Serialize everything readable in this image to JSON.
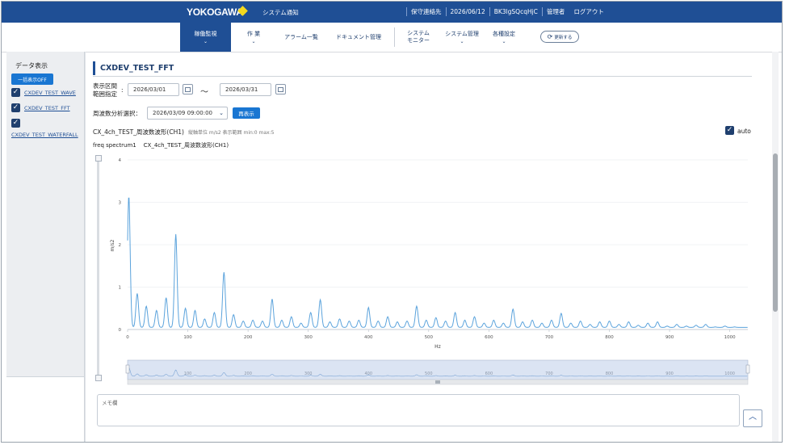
{
  "header": {
    "logo": "YOKOGAWA",
    "system_notice": "システム通知",
    "maintenance_contact": "保守連絡先",
    "date": "2026/06/12",
    "user_id": "BK3lgSQcqHjC",
    "role": "管理者",
    "logout": "ログアウト"
  },
  "nav": {
    "items": [
      {
        "label": "稼働監視",
        "chevron": true,
        "active": true
      },
      {
        "label": "作 業",
        "chevron": true
      },
      {
        "label": "アラーム一覧",
        "chevron": false
      },
      {
        "label": "ドキュメント管理",
        "chevron": false
      },
      {
        "label": "システム\nモニター",
        "chevron": false
      },
      {
        "label": "システム管理",
        "chevron": true
      },
      {
        "label": "各種設定",
        "chevron": true
      }
    ],
    "refresh": "更新する"
  },
  "sidebar": {
    "title": "データ表示",
    "toggle_all": "一括表示OFF",
    "items": [
      {
        "label": "CXDEV_TEST_WAVE",
        "checked": true
      },
      {
        "label": "CXDEV_TEST_FFT",
        "checked": true
      },
      {
        "label": "CXDEV_TEST_WATERFALL",
        "checked": true
      }
    ]
  },
  "main": {
    "title": "CXDEV_TEST_FFT",
    "range_label": "表示区間\n範囲指定",
    "date_from": "2026/03/01",
    "tilde": "〜",
    "date_to": "2026/03/31",
    "freq_label": "周波数分析選択：",
    "freq_value": "2026/03/09 09:00:00",
    "redisplay": "再表示",
    "chart_header": "CX_4ch_TEST_周波数波形(CH1)",
    "chart_header_sub": "縦軸単位 m/s2 表示範囲 min:0 max:5",
    "auto_label": "auto",
    "chart_subtitle": "freq spectrum1    CX_4ch_TEST_周波数波形(CH1)",
    "memo_label": "メモ欄"
  },
  "chart_data": {
    "type": "line",
    "xlabel": "Hz",
    "ylabel": "m/s2",
    "xlim": [
      0,
      1030
    ],
    "ylim": [
      0,
      4
    ],
    "x_ticks": [
      0,
      100,
      200,
      300,
      400,
      500,
      600,
      700,
      800,
      900,
      1000
    ],
    "y_ticks": [
      0,
      1,
      2,
      3,
      4
    ],
    "series": [
      {
        "color": "#5ba3dc",
        "peaks": [
          [
            2,
            3.15
          ],
          [
            16,
            0.85
          ],
          [
            31,
            0.55
          ],
          [
            48,
            0.45
          ],
          [
            64,
            0.75
          ],
          [
            80,
            2.25
          ],
          [
            96,
            0.5
          ],
          [
            112,
            0.45
          ],
          [
            128,
            0.25
          ],
          [
            144,
            0.4
          ],
          [
            160,
            1.35
          ],
          [
            176,
            0.35
          ],
          [
            192,
            0.2
          ],
          [
            208,
            0.22
          ],
          [
            224,
            0.2
          ],
          [
            240,
            0.72
          ],
          [
            256,
            0.22
          ],
          [
            272,
            0.3
          ],
          [
            288,
            0.15
          ],
          [
            304,
            0.4
          ],
          [
            320,
            0.7
          ],
          [
            336,
            0.18
          ],
          [
            352,
            0.25
          ],
          [
            368,
            0.2
          ],
          [
            384,
            0.22
          ],
          [
            400,
            0.52
          ],
          [
            416,
            0.2
          ],
          [
            432,
            0.3
          ],
          [
            448,
            0.18
          ],
          [
            464,
            0.2
          ],
          [
            480,
            0.55
          ],
          [
            496,
            0.22
          ],
          [
            512,
            0.28
          ],
          [
            528,
            0.2
          ],
          [
            544,
            0.4
          ],
          [
            560,
            0.22
          ],
          [
            576,
            0.3
          ],
          [
            592,
            0.15
          ],
          [
            608,
            0.22
          ],
          [
            624,
            0.15
          ],
          [
            640,
            0.48
          ],
          [
            656,
            0.18
          ],
          [
            672,
            0.22
          ],
          [
            688,
            0.15
          ],
          [
            704,
            0.22
          ],
          [
            720,
            0.38
          ],
          [
            736,
            0.15
          ],
          [
            752,
            0.2
          ],
          [
            768,
            0.12
          ],
          [
            784,
            0.18
          ],
          [
            800,
            0.2
          ],
          [
            816,
            0.12
          ],
          [
            832,
            0.18
          ],
          [
            848,
            0.1
          ],
          [
            864,
            0.15
          ],
          [
            880,
            0.18
          ],
          [
            896,
            0.08
          ],
          [
            912,
            0.12
          ],
          [
            928,
            0.08
          ],
          [
            944,
            0.1
          ],
          [
            960,
            0.12
          ],
          [
            976,
            0.06
          ],
          [
            992,
            0.08
          ],
          [
            1008,
            0.06
          ],
          [
            1024,
            0.05
          ]
        ],
        "baseline": 0.05
      }
    ],
    "navigator": {
      "xlim": [
        0,
        1030
      ],
      "x_ticks": [
        100,
        200,
        300,
        400,
        500,
        600,
        700,
        800,
        900,
        1000
      ]
    }
  }
}
